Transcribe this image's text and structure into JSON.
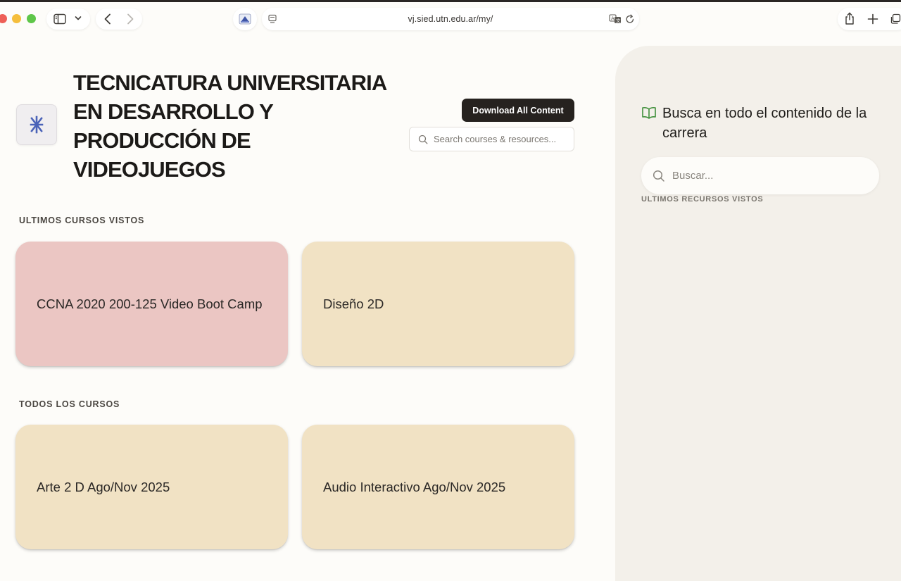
{
  "browser": {
    "url": "vj.sied.utn.edu.ar/my/"
  },
  "header": {
    "title": "TECNICATURA UNIVERSITARIA EN DESARROLLO Y PRODUCCIÓN DE VIDEOJUEGOS",
    "download_label": "Download All Content",
    "search_placeholder": "Search courses & resources..."
  },
  "recent_courses": {
    "label": "ULTIMOS CURSOS VISTOS",
    "items": [
      {
        "title": "CCNA 2020 200-125 Video Boot Camp",
        "color": "#ebc6c3"
      },
      {
        "title": "Diseño 2D",
        "color": "#f1e2c4"
      }
    ]
  },
  "all_courses": {
    "label": "TODOS LOS CURSOS",
    "items": [
      {
        "title": "Arte 2 D Ago/Nov 2025",
        "color": "#f1e2c4"
      },
      {
        "title": "Audio Interactivo Ago/Nov 2025",
        "color": "#f1e2c4"
      }
    ]
  },
  "side_panel": {
    "icon": "book-open-icon",
    "heading": "Busca en todo el contenido de la carrera",
    "search_placeholder": "Buscar...",
    "recent_resources_label": "ULTIMOS RECURSOS VISTOS"
  },
  "colors": {
    "page_bg": "#fdfcf9",
    "panel_bg": "#f3f0ea",
    "button_bg": "#26221f",
    "book_icon": "#3f8f3a",
    "logo_mark": "#4b63b8"
  }
}
